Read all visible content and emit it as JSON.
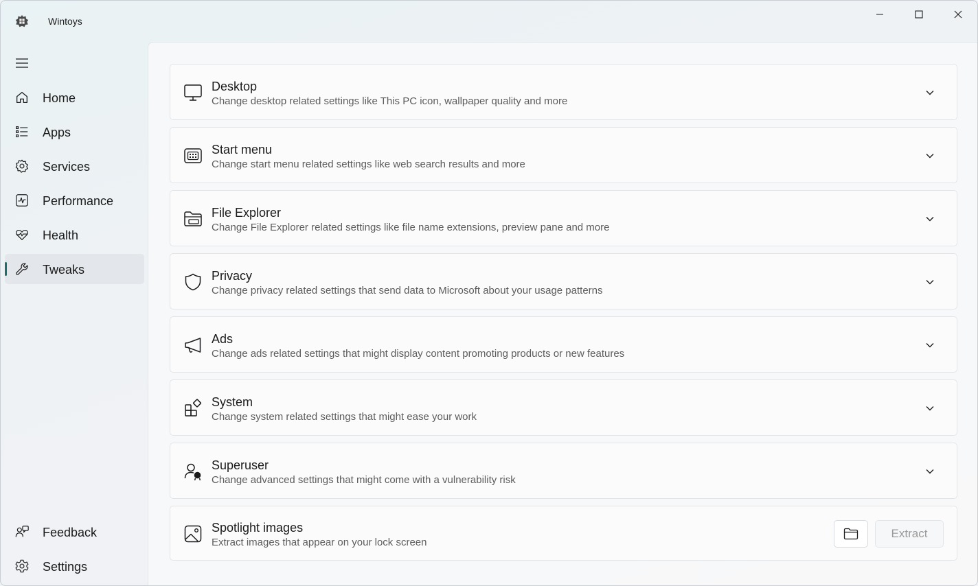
{
  "window": {
    "title": "Wintoys"
  },
  "sidebar": {
    "items": [
      {
        "label": "Home",
        "icon": "home-icon"
      },
      {
        "label": "Apps",
        "icon": "apps-list-icon"
      },
      {
        "label": "Services",
        "icon": "services-gear-icon"
      },
      {
        "label": "Performance",
        "icon": "performance-pulse-icon"
      },
      {
        "label": "Health",
        "icon": "heart-pulse-icon"
      },
      {
        "label": "Tweaks",
        "icon": "wrench-icon",
        "selected": true
      }
    ],
    "footer": [
      {
        "label": "Feedback",
        "icon": "feedback-people-icon"
      },
      {
        "label": "Settings",
        "icon": "settings-gear-icon"
      }
    ]
  },
  "cards": [
    {
      "title": "Desktop",
      "description": "Change desktop related settings like This PC icon, wallpaper quality and more",
      "icon": "desktop-monitor-icon"
    },
    {
      "title": "Start menu",
      "description": "Change start menu related settings like web search results and more",
      "icon": "start-menu-icon"
    },
    {
      "title": "File Explorer",
      "description": "Change File Explorer related settings like file name extensions, preview pane and more",
      "icon": "folder-open-icon"
    },
    {
      "title": "Privacy",
      "description": "Change privacy related settings that send data to Microsoft about your usage patterns",
      "icon": "shield-icon"
    },
    {
      "title": "Ads",
      "description": "Change ads related settings that might display content promoting products or new features",
      "icon": "megaphone-icon"
    },
    {
      "title": "System",
      "description": "Change system related settings that might ease your work",
      "icon": "system-apps-icon"
    },
    {
      "title": "Superuser",
      "description": "Change advanced settings that might come with a vulnerability risk",
      "icon": "superuser-icon"
    }
  ],
  "spotlight": {
    "title": "Spotlight images",
    "description": "Extract images that appear on your lock screen",
    "icon": "image-icon",
    "extract_label": "Extract",
    "extract_enabled": false
  },
  "colors": {
    "accent": "#1f6e69",
    "selected_nav_bg": "#e3e6ea",
    "card_bg": "#fbfbfc"
  }
}
